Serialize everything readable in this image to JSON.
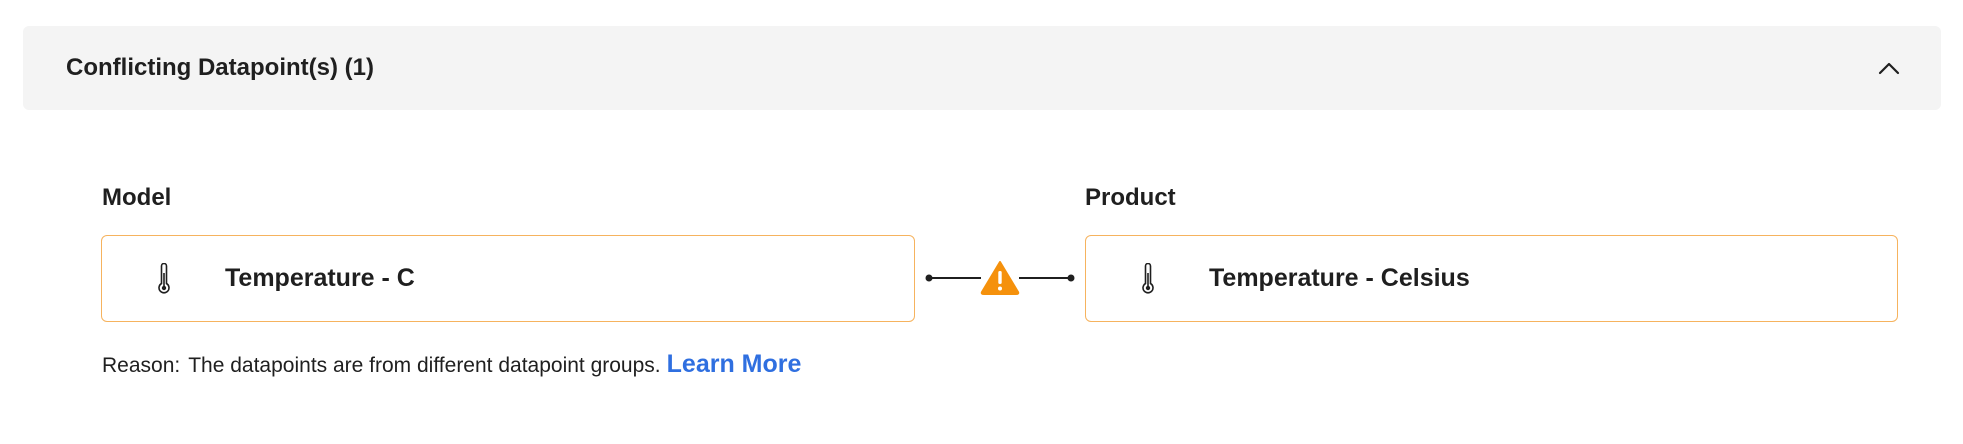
{
  "panel": {
    "title": "Conflicting Datapoint(s) (1)",
    "expanded": true,
    "toggle_icon": "chevron-up-icon"
  },
  "model": {
    "label": "Model",
    "datapoint": "Temperature - C",
    "icon": "thermometer-icon"
  },
  "product": {
    "label": "Product",
    "datapoint": "Temperature - Celsius",
    "icon": "thermometer-icon"
  },
  "conflict": {
    "icon": "warning-icon",
    "color": "#f5910c"
  },
  "reason": {
    "label": "Reason:",
    "text": "The datapoints are from different datapoint groups.",
    "link": "Learn More"
  },
  "colors": {
    "box_border": "#f6b35e",
    "link": "#2f6fe0",
    "header_bg": "#f4f4f4"
  }
}
